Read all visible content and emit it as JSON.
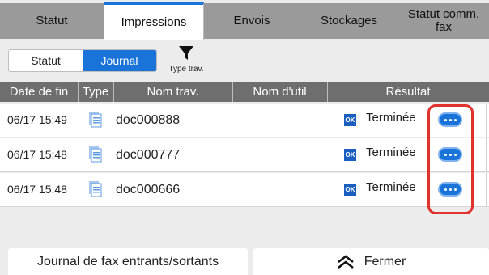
{
  "tabs": [
    {
      "label": "Statut"
    },
    {
      "label": "Impressions",
      "active": true
    },
    {
      "label": "Envois"
    },
    {
      "label": "Stockages"
    },
    {
      "label_line1": "Statut comm.",
      "label_line2": "fax"
    }
  ],
  "subtabs": {
    "status": "Statut",
    "journal": "Journal",
    "active": "Journal"
  },
  "filter": {
    "label": "Type trav.",
    "icon": "funnel-icon"
  },
  "columns": {
    "end_date": "Date de fin",
    "type": "Type",
    "job_name": "Nom trav.",
    "user_name": "Nom d'util",
    "result": "Résultat"
  },
  "rows": [
    {
      "date": "06/17 15:49",
      "name": "doc000888",
      "ok": "OK",
      "result": "Terminée"
    },
    {
      "date": "06/17 15:48",
      "name": "doc000777",
      "ok": "OK",
      "result": "Terminée"
    },
    {
      "date": "06/17 15:48",
      "name": "doc000666",
      "ok": "OK",
      "result": "Terminée"
    }
  ],
  "buttons": {
    "fax_log": "Journal de fax entrants/sortants",
    "close": "Fermer"
  },
  "colors": {
    "accent": "#1a73d9",
    "highlight": "#e0322e",
    "header_bg": "#6e6e6e"
  }
}
